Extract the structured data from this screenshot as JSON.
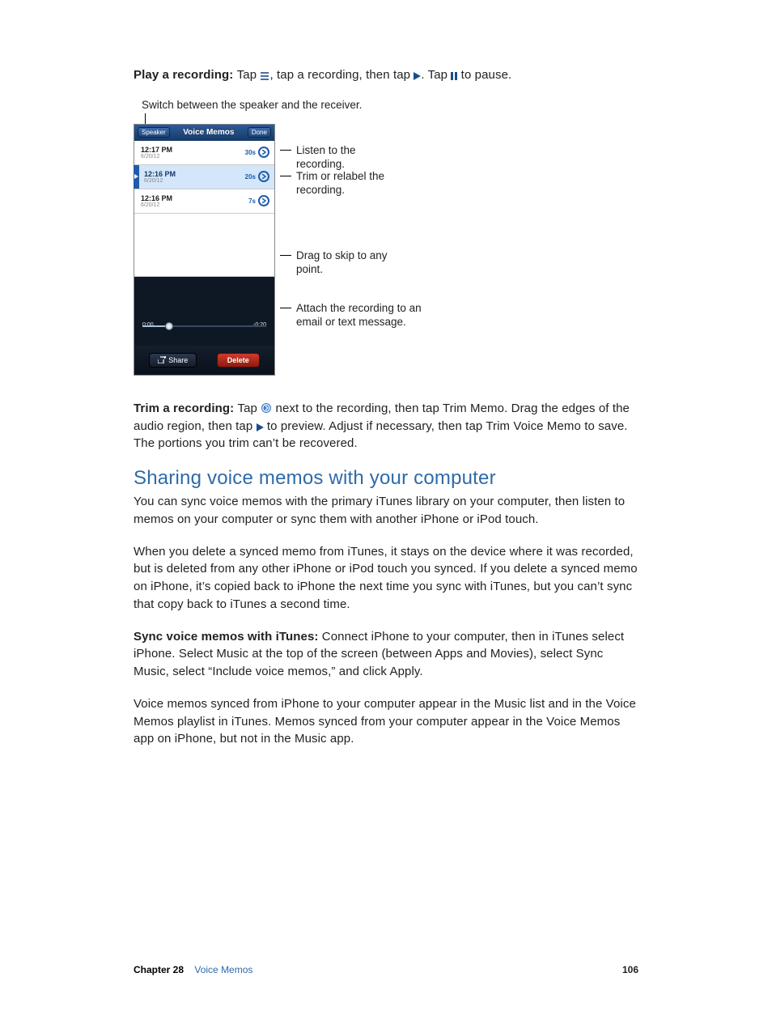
{
  "intro": {
    "title_bold": "Play a recording:  ",
    "t1": "Tap ",
    "t2": ", tap a recording, then tap ",
    "t3": ". Tap ",
    "t4": " to pause."
  },
  "caption_top": "Switch between the speaker and the receiver.",
  "phone": {
    "header": {
      "left": "Speaker",
      "title": "Voice Memos",
      "right": "Done"
    },
    "rows": [
      {
        "time": "12:17 PM",
        "date": "6/20/12",
        "dur": "30s",
        "selected": false
      },
      {
        "time": "12:16 PM",
        "date": "6/20/12",
        "dur": "20s",
        "selected": true
      },
      {
        "time": "12:16 PM",
        "date": "6/20/12",
        "dur": "7s",
        "selected": false
      }
    ],
    "scrub": {
      "left": "0:00",
      "right": "-0:20"
    },
    "bottom": {
      "share": "Share",
      "delete": "Delete"
    }
  },
  "callouts": {
    "listen": "Listen to the recording.",
    "trim": "Trim or relabel the recording.",
    "drag": "Drag to skip to any point.",
    "attach": "Attach the recording to an email or text message."
  },
  "trim_para": {
    "b": "Trim a recording:  ",
    "t1": "Tap ",
    "t2": " next to the recording, then tap Trim Memo. Drag the edges of the audio region, then tap ",
    "t3": " to preview. Adjust if necessary, then tap Trim Voice Memo to save. The portions you trim can’t be recovered."
  },
  "section_heading": "Sharing voice memos with your computer",
  "p1": "You can sync voice memos with the primary iTunes library on your computer, then listen to memos on your computer or sync them with another iPhone or iPod touch.",
  "p2": "When you delete a synced memo from iTunes, it stays on the device where it was recorded, but is deleted from any other iPhone or iPod touch you synced. If you delete a synced memo on iPhone, it’s copied back to iPhone the next time you sync with iTunes, but you can’t sync that copy back to iTunes a second time.",
  "p3": {
    "b": "Sync voice memos with iTunes:  ",
    "rest": "Connect iPhone to your computer, then in iTunes select iPhone. Select Music at the top of the screen (between Apps and Movies), select Sync Music, select “Include voice memos,” and click Apply."
  },
  "p4": "Voice memos synced from iPhone to your computer appear in the Music list and in the Voice Memos playlist in iTunes. Memos synced from your computer appear in the Voice Memos app on iPhone, but not in the Music app.",
  "footer": {
    "chapter_label": "Chapter  28",
    "chapter_title": "Voice Memos",
    "page": "106"
  }
}
